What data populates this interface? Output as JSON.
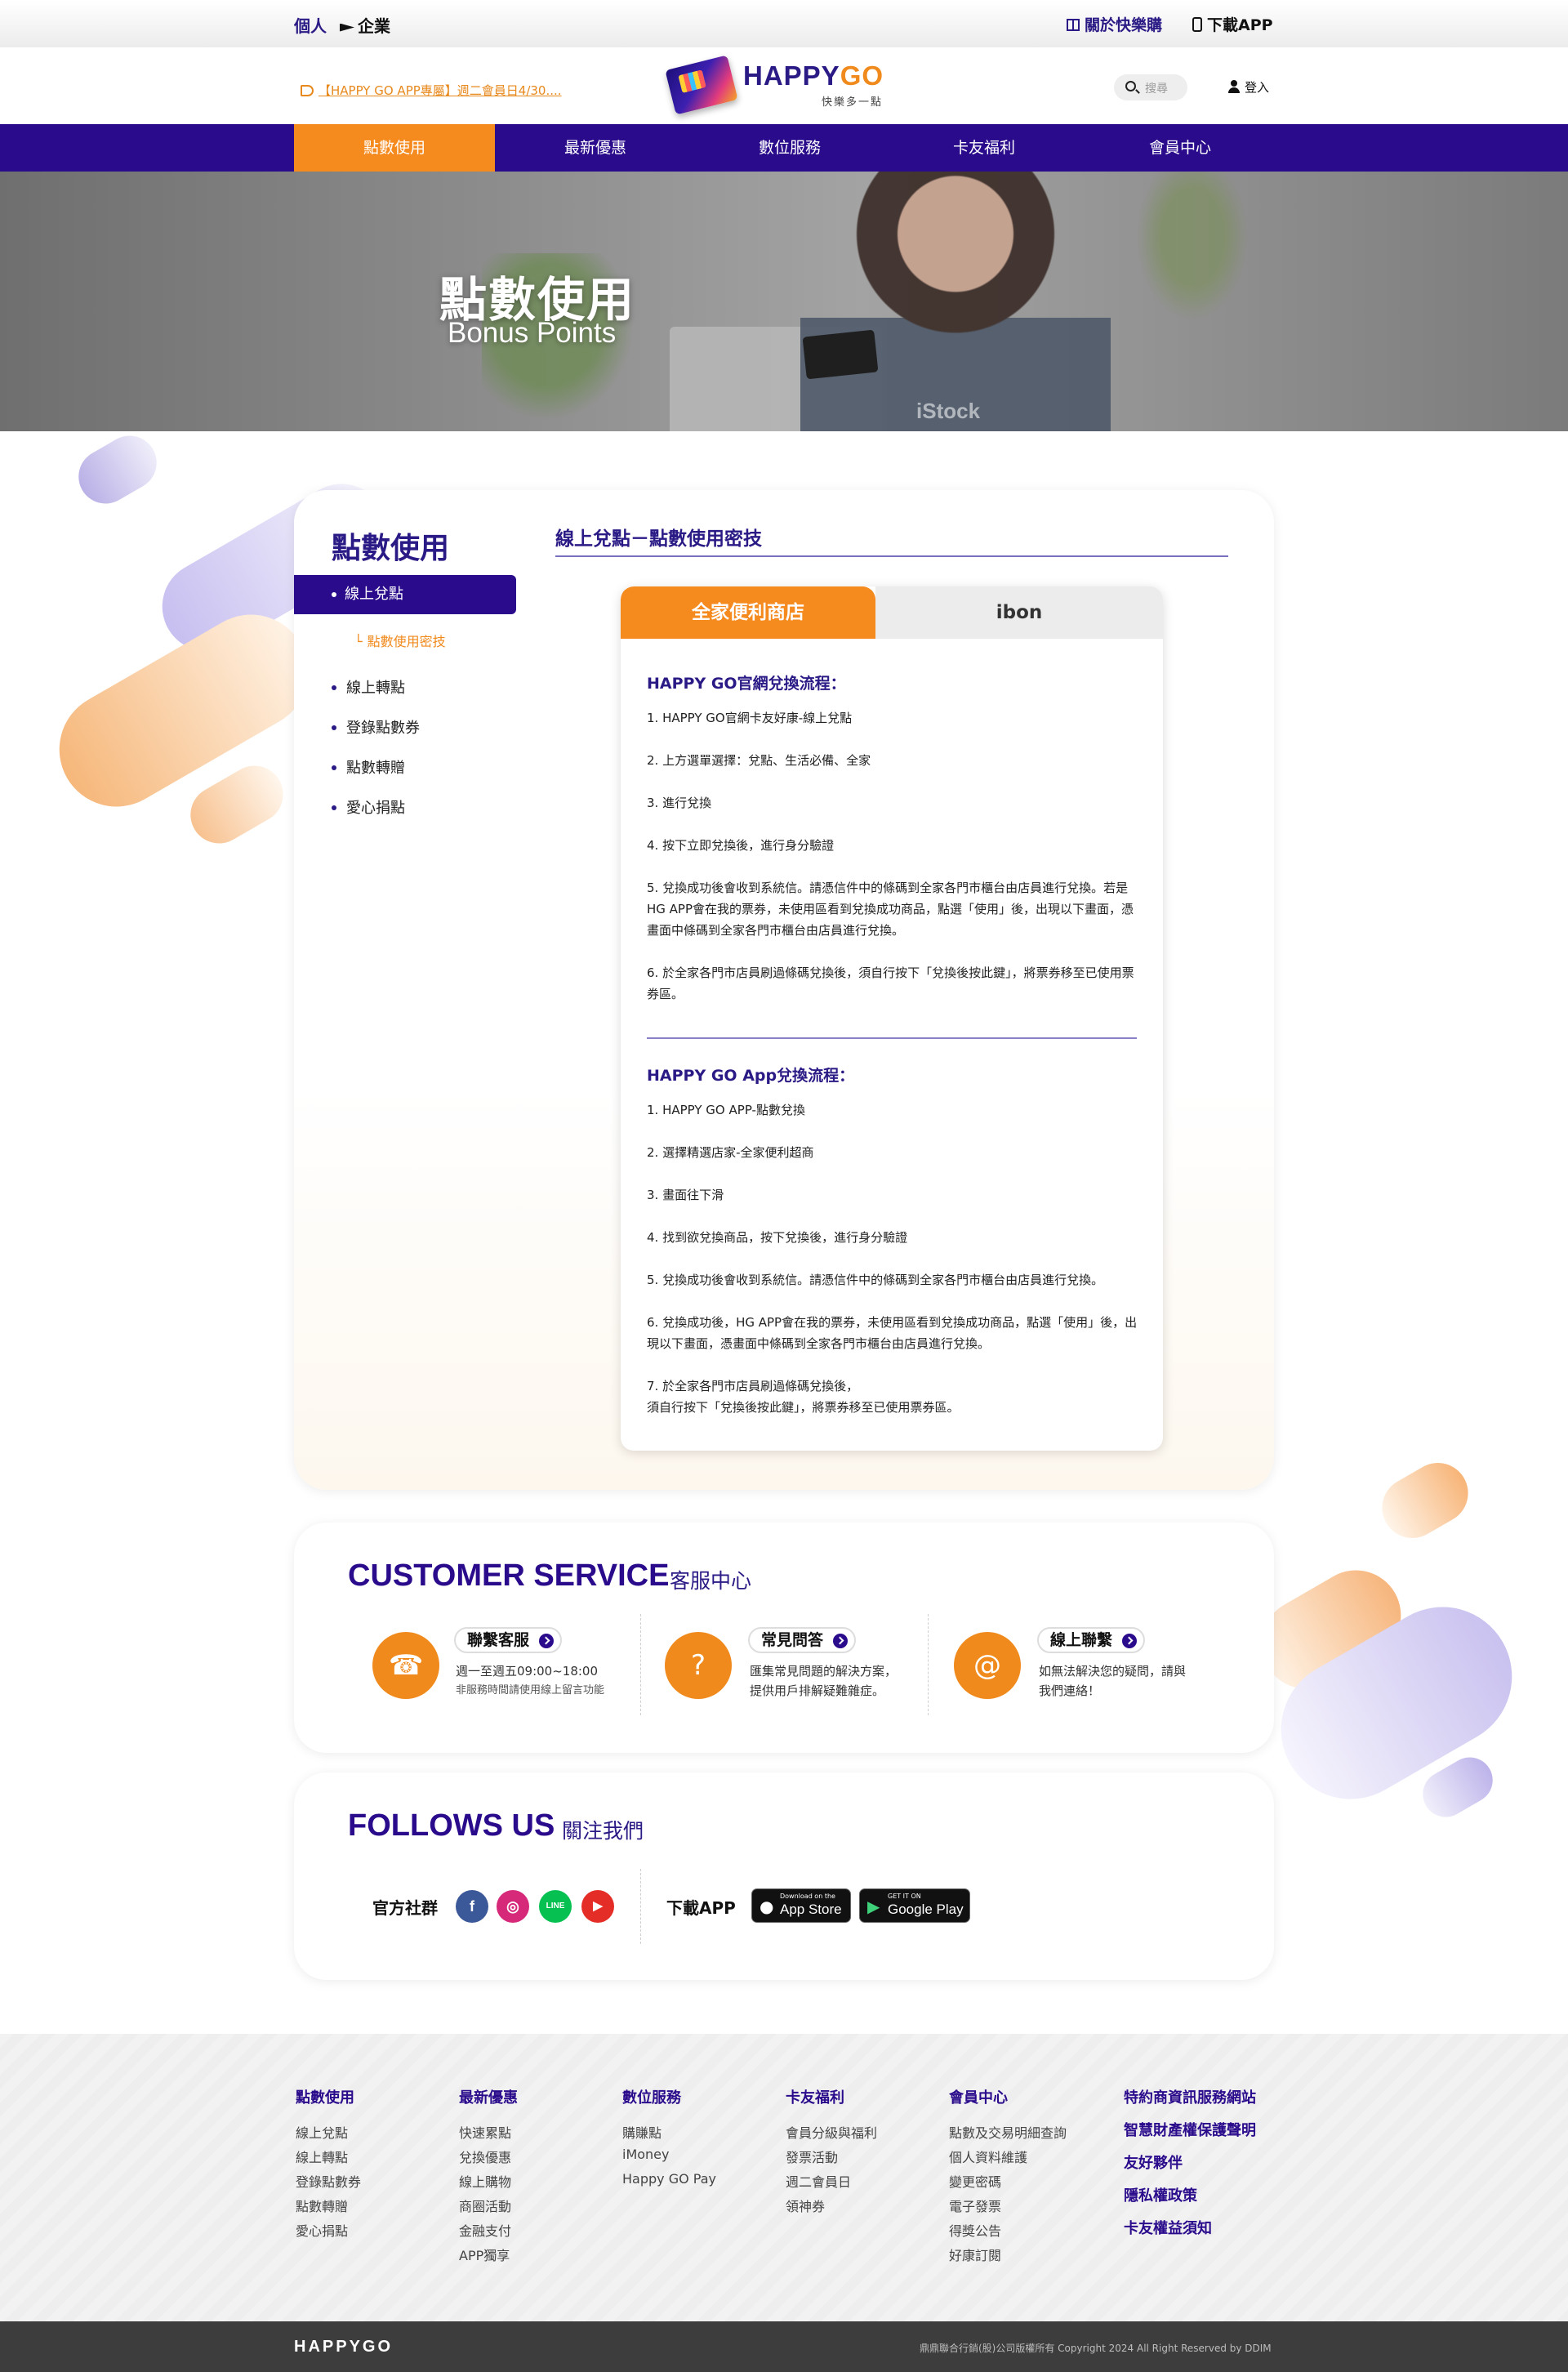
{
  "topbar": {
    "personal": "個人",
    "business": "企業",
    "about": "關於快樂購",
    "download": "下載APP"
  },
  "header": {
    "marquee": "【HAPPY GO APP專屬】週二會員日4/30....",
    "logo_main": "HAPPY",
    "logo_go": "GO",
    "logo_sub": "快樂多一點",
    "search_placeholder": "搜尋",
    "login": "登入"
  },
  "nav": {
    "items": [
      "點數使用",
      "最新優惠",
      "數位服務",
      "卡友福利",
      "會員中心"
    ]
  },
  "hero": {
    "title": "點數使用",
    "subtitle": "Bonus Points",
    "watermark": "iStock"
  },
  "sidebar": {
    "title": "點數使用",
    "active": "線上兌點",
    "sub": "點數使用密技",
    "items": [
      "線上轉點",
      "登錄點數券",
      "點數轉贈",
      "愛心捐點"
    ]
  },
  "content": {
    "heading": "線上兌點－點數使用密技",
    "tabs": [
      "全家便利商店",
      "ibon"
    ],
    "web_title": "HAPPY GO官網兌換流程：",
    "web_steps": [
      "1. HAPPY GO官網卡友好康-線上兌點",
      "2. 上方選單選擇：兌點、生活必備、全家",
      "3. 進行兌換",
      "4. 按下立即兌換後，進行身分驗證",
      "5. 兌換成功後會收到系統信。請憑信件中的條碼到全家各門市櫃台由店員進行兌換。若是HG APP會在我的票券，未使用區看到兌換成功商品，點選「使用」後，出現以下畫面，憑畫面中條碼到全家各門市櫃台由店員進行兌換。",
      "6. 於全家各門市店員刷過條碼兌換後，須自行按下「兌換後按此鍵」，將票券移至已使用票券區。"
    ],
    "app_title": "HAPPY GO App兌換流程：",
    "app_steps": [
      "1. HAPPY GO APP-點數兌換",
      "2. 選擇精選店家-全家便利超商",
      "3. 畫面往下滑",
      "4. 找到欲兌換商品，按下兌換後，進行身分驗證",
      " 5. 兌換成功後會收到系統信。請憑信件中的條碼到全家各門市櫃台由店員進行兌換。",
      "6. 兌換成功後，HG APP會在我的票券，未使用區看到兌換成功商品，點選「使用」後，出現以下畫面，憑畫面中條碼到全家各門市櫃台由店員進行兌換。",
      "7. 於全家各門市店員刷過條碼兌換後，\n須自行按下「兌換後按此鍵」，將票券移至已使用票券區。"
    ]
  },
  "customer_service": {
    "title": "CUSTOMER SERVICE",
    "subtitle": "客服中心",
    "items": [
      {
        "label": "聯繫客服",
        "desc": "週一至週五09:00~18:00",
        "note": "非服務時間請使用線上留言功能",
        "icon": "phone-icon"
      },
      {
        "label": "常見問答",
        "desc": "匯集常見問題的解決方案，",
        "note": "提供用戶排解疑難雜症。",
        "icon": "faq-icon"
      },
      {
        "label": "線上聯繫",
        "desc": "如無法解決您的疑問，請與",
        "note": "我們連絡！",
        "icon": "mail-icon"
      }
    ]
  },
  "follows": {
    "title": "FOLLOWS US",
    "subtitle": "關注我們",
    "social_label": "官方社群",
    "download_label": "下載APP",
    "social": [
      {
        "name": "facebook",
        "glyph": "f",
        "color": "#3b5998"
      },
      {
        "name": "instagram",
        "glyph": "◎",
        "color": "#d6297a"
      },
      {
        "name": "line",
        "glyph": "LINE",
        "color": "#06c152"
      },
      {
        "name": "youtube",
        "glyph": "▶",
        "color": "#e52d27"
      }
    ],
    "appstore": {
      "small": "Download on the",
      "big": "App Store"
    },
    "googleplay": {
      "small": "GET IT ON",
      "big": "Google Play"
    }
  },
  "footer": {
    "columns": [
      {
        "head": "點數使用",
        "links": [
          "線上兌點",
          "線上轉點",
          "登錄點數券",
          "點數轉贈",
          "愛心捐點"
        ]
      },
      {
        "head": "最新優惠",
        "links": [
          "快速累點",
          "兌換優惠",
          "線上購物",
          "商圈活動",
          "金融支付",
          "APP獨享"
        ]
      },
      {
        "head": "數位服務",
        "links": [
          "購賺點",
          "iMoney",
          "Happy GO Pay"
        ]
      },
      {
        "head": "卡友福利",
        "links": [
          "會員分級與福利",
          "發票活動",
          "週二會員日",
          "領神券"
        ]
      },
      {
        "head": "會員中心",
        "links": [
          "點數及交易明細查詢",
          "個人資料維護",
          "變更密碼",
          "電子發票",
          "得獎公告",
          "好康訂閱"
        ]
      }
    ],
    "right_links": [
      "特約商資訊服務網站",
      "智慧財產權保護聲明",
      "友好夥伴",
      "隱私權政策",
      "卡友權益須知"
    ],
    "brand": "HAPPYGO",
    "copyright": "鼎鼎聯合行銷(股)公司版權所有 Copyright 2024 All Right Reserved by DDIM"
  },
  "colors": {
    "brand_purple": "#2a0b8c",
    "brand_orange": "#f58a1f"
  }
}
